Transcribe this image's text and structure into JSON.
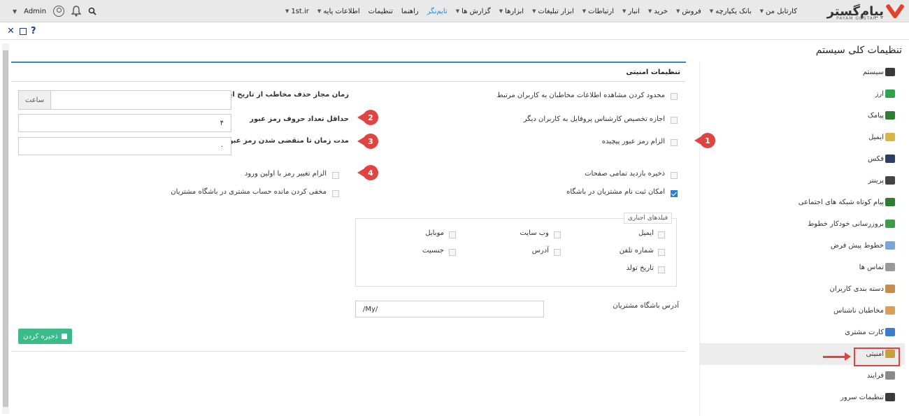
{
  "topnav": {
    "logo_text": "پیام‌گستر",
    "logo_sub": "PAYAM GOSTAR",
    "items": [
      {
        "label": "کارتابل من"
      },
      {
        "label": "بانک یکپارچه"
      },
      {
        "label": "فروش"
      },
      {
        "label": "خرید"
      },
      {
        "label": "انبار"
      },
      {
        "label": "ارتباطات"
      },
      {
        "label": "ابزار تبلیغات"
      },
      {
        "label": "ابزارها"
      },
      {
        "label": "گزارش ها"
      },
      {
        "label": "تایم‌نگر"
      },
      {
        "label": "راهنما"
      },
      {
        "label": "تنظیمات"
      },
      {
        "label": "اطلاعات پایه"
      },
      {
        "label": "1st.ir"
      }
    ],
    "user": "Admin"
  },
  "window": {
    "help": "?"
  },
  "page_title": "تنظیمات کلی سیستم",
  "sidebar": {
    "items": [
      {
        "label": "سیستم",
        "color": "#3a3a3a"
      },
      {
        "label": "ارز",
        "color": "#2fa34a"
      },
      {
        "label": "پیامک",
        "color": "#2e7d32"
      },
      {
        "label": "ایمیل",
        "color": "#d9b44a"
      },
      {
        "label": "فکس",
        "color": "#2b3e63"
      },
      {
        "label": "پرینتر",
        "color": "#444444"
      },
      {
        "label": "پیام کوتاه شبکه های اجتماعی",
        "color": "#2e7d32"
      },
      {
        "label": "بروزرسانی خودکار خطوط",
        "color": "#3f9a4a"
      },
      {
        "label": "خطوط پیش فرض",
        "color": "#7aa7d6"
      },
      {
        "label": "تماس ها",
        "color": "#999999"
      },
      {
        "label": "دسته بندی کاربران",
        "color": "#c78b4a"
      },
      {
        "label": "مخاطبان ناشناس",
        "color": "#d4a05a"
      },
      {
        "label": "کارت مشتری",
        "color": "#3d7cc9"
      },
      {
        "label": "امنیتی",
        "color": "#c6a040"
      },
      {
        "label": "فرایند",
        "color": "#8a8a8a"
      },
      {
        "label": "تنظیمات سرور",
        "color": "#3a3a3a"
      }
    ]
  },
  "security": {
    "title": "تنظیمات امنیتی",
    "restrict_view": "محدود کردن مشاهده اطلاعات مخاطبان به کاربران مرتبط",
    "allow_assign": "اجازه تخصیص کارشناس پروفایل به کاربران دیگر",
    "complex_password": "الزام رمز عبور پیچیده",
    "save_visits": "ذخیره بازدید تمامی صفحات",
    "customer_register": "امکان ثبت نام مشتریان در باشگاه",
    "delete_time_label": "زمان مجاز حذف مخاطب از تاریخ ایجاد",
    "delete_time_unit": "ساعت",
    "min_chars_label": "حداقل تعداد حروف رمز عبور",
    "min_chars_value": "۴",
    "expire_label": "مدت زمان تا منقضی شدن رمز عبور",
    "expire_value": "۰",
    "force_change": "الزام تغییر رمز با اولین ورود",
    "hide_balance": "مخفی کردن مانده حساب مشتری در باشگاه مشتریان",
    "required_fields_legend": "فیلدهای اجباری",
    "fields": {
      "email": "ایمیل",
      "website": "وب سایت",
      "mobile": "موبایل",
      "phone": "شماره تلفن",
      "address": "آدرس",
      "gender": "جنسیت",
      "birthdate": "تاریخ تولد"
    },
    "club_address_label": "آدرس باشگاه مشتریان",
    "club_address_value": "/My/",
    "save_label": "ذخیره کردن"
  },
  "badges": [
    "1",
    "2",
    "3",
    "4"
  ]
}
